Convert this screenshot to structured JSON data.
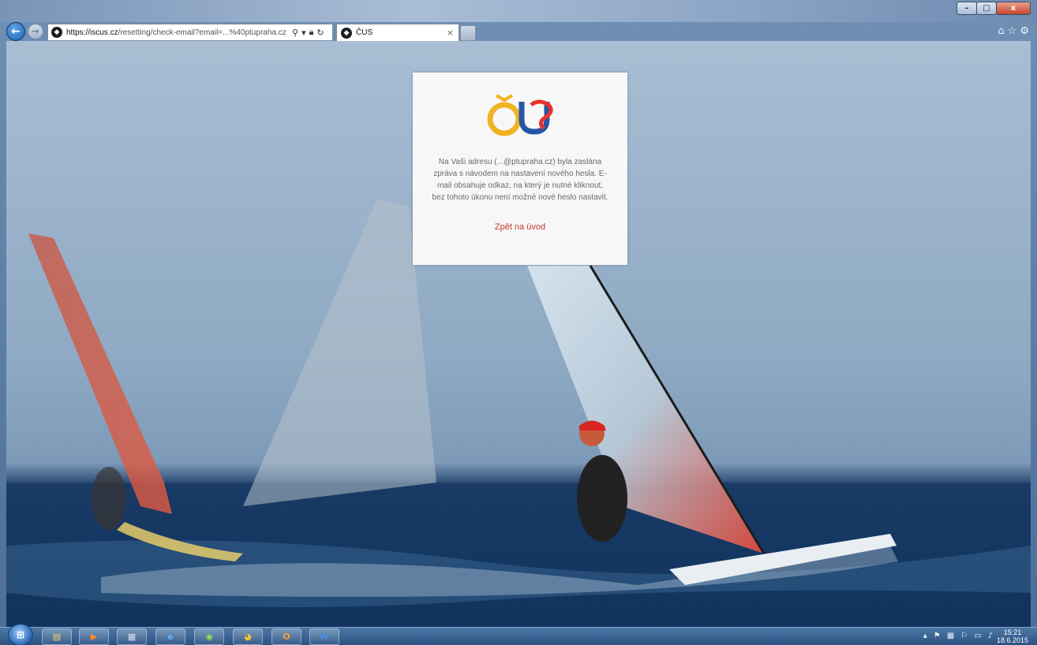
{
  "browser": {
    "address": {
      "url_host": "https://iscus.cz",
      "url_path": "/resetting/check-email?email=...%40ptupraha.cz"
    },
    "tab": {
      "title": "ČUS",
      "close_glyph": "×"
    },
    "site_icon_glyph": "◆",
    "window_controls": {
      "minimize": "–",
      "maximize": "□",
      "close": "x"
    },
    "toolbar_icons": [
      "home-icon",
      "favorites-icon",
      "settings-icon"
    ]
  },
  "card": {
    "logo_text": "ČUS",
    "message": "Na Vaši adresu (...@ptupraha.cz) byla zaslána zpráva s návodem na nastavení nového hesla. E-mail obsahuje odkaz, na který je nutné kliknout, bez tohoto úkonu není možné nové heslo nastavit.",
    "back_link": "Zpět na úvod",
    "link_color": "#c0392b"
  },
  "taskbar": {
    "apps": [
      {
        "name": "file-explorer",
        "glyph": "▤",
        "color": "#f1d36b"
      },
      {
        "name": "media-player",
        "glyph": "▶",
        "color": "#ff8a2a"
      },
      {
        "name": "calculator",
        "glyph": "▦",
        "color": "#dbe3ee"
      },
      {
        "name": "internet-explorer",
        "glyph": "e",
        "color": "#63b3ff"
      },
      {
        "name": "app-green",
        "glyph": "◉",
        "color": "#8fdd5a"
      },
      {
        "name": "chrome",
        "glyph": "◕",
        "color": "#f2c230"
      },
      {
        "name": "outlook",
        "glyph": "O",
        "color": "#f5a524"
      },
      {
        "name": "word",
        "glyph": "W",
        "color": "#4c8de4"
      }
    ],
    "clock": {
      "time": "15:21",
      "date": "18.6.2015"
    }
  }
}
